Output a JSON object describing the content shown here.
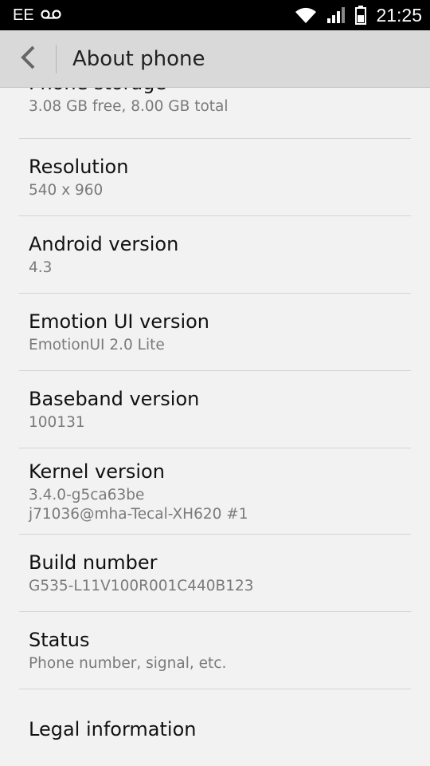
{
  "status_bar": {
    "carrier": "EE",
    "voicemail_icon": "voicemail-icon",
    "wifi_icon": "wifi-icon",
    "signal_icon": "signal-icon",
    "battery_icon": "battery-icon",
    "time": "21:25"
  },
  "header": {
    "back_icon": "chevron-left-icon",
    "title": "About phone"
  },
  "items": [
    {
      "title": "Phone storage",
      "subtitle": "3.08 GB free, 8.00 GB total"
    },
    {
      "title": "Resolution",
      "subtitle": "540 x 960"
    },
    {
      "title": "Android version",
      "subtitle": "4.3"
    },
    {
      "title": "Emotion UI version",
      "subtitle": "EmotionUI 2.0 Lite"
    },
    {
      "title": "Baseband version",
      "subtitle": "100131"
    },
    {
      "title": "Kernel version",
      "subtitle": "3.4.0-g5ca63be\nj71036@mha-Tecal-XH620 #1"
    },
    {
      "title": "Build number",
      "subtitle": "G535-L11V100R001C440B123"
    },
    {
      "title": "Status",
      "subtitle": "Phone number, signal, etc."
    },
    {
      "title": "Legal information",
      "subtitle": ""
    }
  ]
}
